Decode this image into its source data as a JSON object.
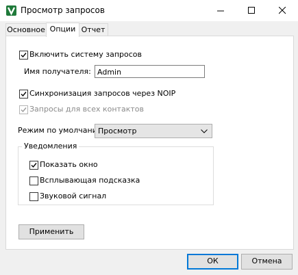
{
  "window": {
    "title": "Просмотр запросов",
    "icon": "green-v-app-icon"
  },
  "tabs": [
    {
      "label": "Основное"
    },
    {
      "label": "Опции"
    },
    {
      "label": "Отчет"
    }
  ],
  "active_tab": "Опции",
  "options": {
    "enable_system": {
      "label": "Включить систему запросов",
      "checked": true
    },
    "recipient": {
      "label": "Имя получателя:",
      "value": "Admin"
    },
    "sync_noip": {
      "label": "Синхронизация запросов через NOIP",
      "checked": true
    },
    "all_contacts": {
      "label": "Запросы для всех контактов",
      "checked": true,
      "disabled": true
    },
    "default_mode": {
      "label": "Режим по умолчанию:",
      "value": "Просмотр"
    }
  },
  "notifications": {
    "title": "Уведомления",
    "items": [
      {
        "label": "Показать окно",
        "checked": true
      },
      {
        "label": "Всплывающая подсказка",
        "checked": false
      },
      {
        "label": "Звуковой сигнал",
        "checked": false
      }
    ]
  },
  "buttons": {
    "apply": "Применить",
    "ok": "ОК",
    "cancel": "Отмена"
  }
}
